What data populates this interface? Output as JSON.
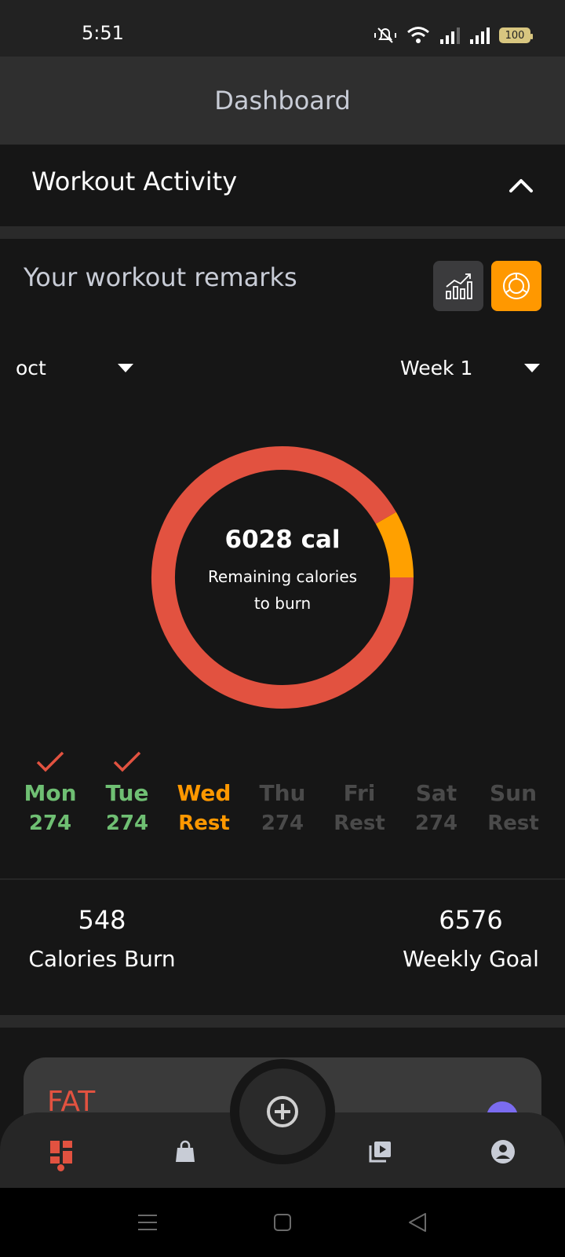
{
  "status": {
    "time": "5:51",
    "battery": "100"
  },
  "header": {
    "title": "Dashboard"
  },
  "section": {
    "title": "Workout Activity"
  },
  "remarks": {
    "title": "Your workout remarks"
  },
  "filters": {
    "month": "oct",
    "week": "Week 1"
  },
  "donut": {
    "value": "6028 cal",
    "caption": "Remaining calories to burn",
    "segments": [
      {
        "fraction": 0.917,
        "color": "#e25240"
      },
      {
        "fraction": 0.083,
        "color": "#ffa000"
      }
    ]
  },
  "days": [
    {
      "name": "Mon",
      "value": "274",
      "checked": true,
      "color": "#6fbf73"
    },
    {
      "name": "Tue",
      "value": "274",
      "checked": true,
      "color": "#6fbf73"
    },
    {
      "name": "Wed",
      "value": "Rest",
      "checked": false,
      "color": "#ff9800"
    },
    {
      "name": "Thu",
      "value": "274",
      "checked": false,
      "color": "#4a4a4a"
    },
    {
      "name": "Fri",
      "value": "Rest",
      "checked": false,
      "color": "#4a4a4a"
    },
    {
      "name": "Sat",
      "value": "274",
      "checked": false,
      "color": "#4a4a4a"
    },
    {
      "name": "Sun",
      "value": "Rest",
      "checked": false,
      "color": "#4a4a4a"
    }
  ],
  "stats": {
    "burn_value": "548",
    "burn_label": "Calories Burn",
    "goal_value": "6576",
    "goal_label": "Weekly Goal"
  },
  "card": {
    "label": "FAT"
  },
  "colors": {
    "accent": "#ff9800",
    "danger": "#e25240",
    "success": "#6fbf73",
    "check": "#e25240"
  },
  "icons": {
    "nav": [
      "dashboard-icon",
      "shopping-bag-icon",
      "video-library-icon",
      "account-icon"
    ],
    "fab": "add-circle-icon"
  }
}
